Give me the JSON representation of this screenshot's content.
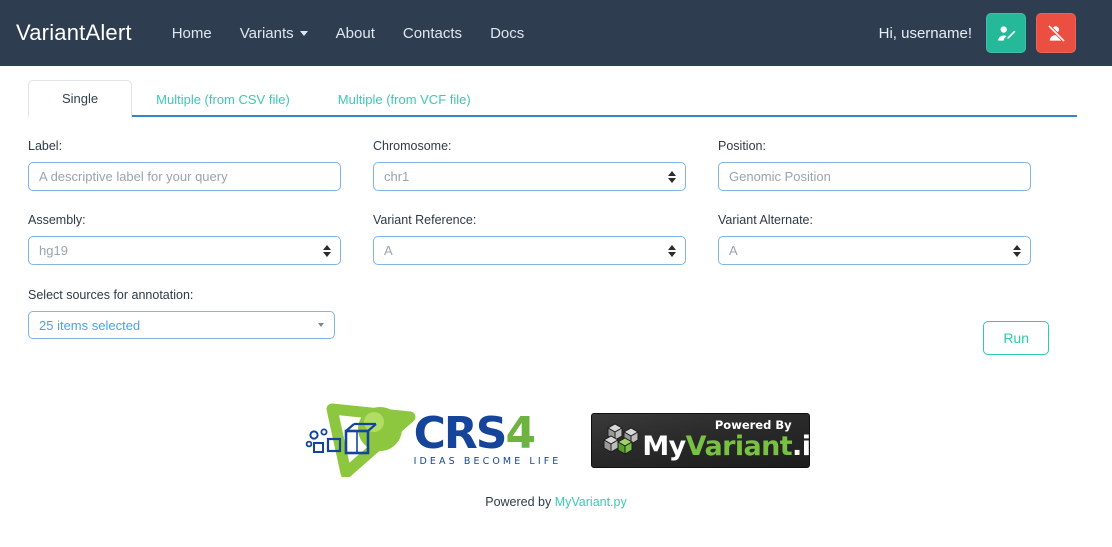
{
  "navbar": {
    "brand": "VariantAlert",
    "links": [
      {
        "label": "Home",
        "icon": null
      },
      {
        "label": "Variants",
        "icon": "chevron-down-icon"
      },
      {
        "label": "About",
        "icon": null
      },
      {
        "label": "Contacts",
        "icon": null
      },
      {
        "label": "Docs",
        "icon": null
      }
    ],
    "greeting": "Hi, username!",
    "edit_user_icon": "user-edit-icon",
    "logout_icon": "user-slash-icon",
    "bg_color": "#2e3e50",
    "edit_btn_color": "#25b99a",
    "logout_btn_color": "#ea4f42"
  },
  "tabs": {
    "items": [
      {
        "label": "Single",
        "active": true
      },
      {
        "label": "Multiple (from CSV file)",
        "active": false
      },
      {
        "label": "Multiple (from VCF file)",
        "active": false
      }
    ],
    "accent_color": "#3cc8b4",
    "underline_color": "#3586c8"
  },
  "form": {
    "label": {
      "label": "Label:",
      "placeholder": "A descriptive label for your query",
      "value": ""
    },
    "chromosome": {
      "label": "Chromosome:",
      "value": "chr1"
    },
    "position": {
      "label": "Position:",
      "placeholder": "Genomic Position",
      "value": ""
    },
    "assembly": {
      "label": "Assembly:",
      "value": "hg19"
    },
    "variant_reference": {
      "label": "Variant Reference:",
      "value": "A"
    },
    "variant_alternate": {
      "label": "Variant Alternate:",
      "value": "A"
    },
    "sources": {
      "label": "Select sources for annotation:",
      "value": "25 items selected"
    },
    "run_button": "Run",
    "input_border_color": "#80b4e2",
    "run_button_color": "#2fcaa9"
  },
  "logos": {
    "crs4": {
      "name": "CRS4",
      "word_main": "CRS",
      "word_accent": "4",
      "tagline": "IDEAS BECOME LIFE"
    },
    "myvariant": {
      "powered_by": "Powered By",
      "name_white": "My",
      "name_green": "Variant",
      "name_suffix": ".info"
    }
  },
  "footer": {
    "prefix": "Powered by",
    "link": "MyVariant.py",
    "link_color": "#3cc8b4"
  }
}
